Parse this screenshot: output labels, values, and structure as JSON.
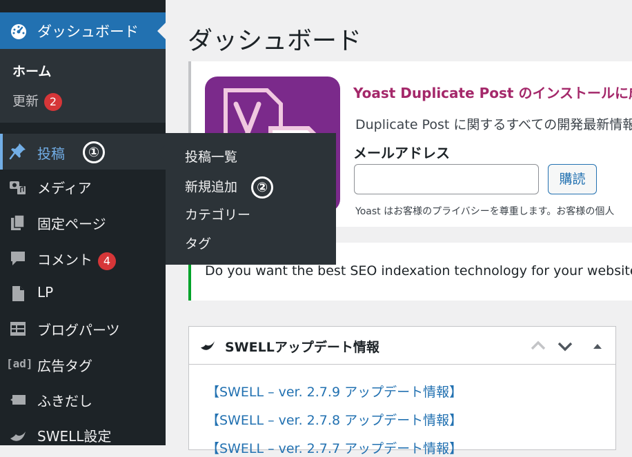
{
  "sidebar": {
    "dashboard": {
      "label": "ダッシュボード",
      "icon": "dashboard-icon"
    },
    "submenu": {
      "home": "ホーム",
      "update": "更新",
      "update_badge": "2"
    },
    "items": [
      {
        "label": "投稿",
        "icon": "pin-icon",
        "annotation": "①"
      },
      {
        "label": "メディア",
        "icon": "media-icon"
      },
      {
        "label": "固定ページ",
        "icon": "pages-icon"
      },
      {
        "label": "コメント",
        "icon": "comment-icon",
        "badge": "4"
      },
      {
        "label": "LP",
        "icon": "document-icon"
      },
      {
        "label": "ブログパーツ",
        "icon": "layout-icon"
      },
      {
        "label": "広告タグ",
        "icon": "ad-icon",
        "icon_text": "[ad]"
      },
      {
        "label": "ふきだし",
        "icon": "speech-bubble-icon"
      },
      {
        "label": "SWELL設定",
        "icon": "swell-icon"
      }
    ]
  },
  "flyout": {
    "items": [
      "投稿一覧",
      "新規追加",
      "カテゴリー",
      "タグ"
    ],
    "annotation": "②"
  },
  "main": {
    "title": "ダッシュボード",
    "yoast": {
      "heading": "Yoast Duplicate Post のインストールに成功",
      "description": "Duplicate Post に関するすべての開発最新情報",
      "email_label": "メールアドレス",
      "email_value": "",
      "subscribe": "購読",
      "privacy": "Yoast はお客様のプライバシーを尊重します。お客様の個人"
    },
    "seo_notice": "Do you want the best SEO indexation technology for your website? Joi",
    "swell": {
      "title": "SWELLアップデート情報",
      "links": [
        "【SWELL – ver. 2.7.9 アップデート情報】",
        "【SWELL – ver. 2.7.8 アップデート情報】",
        "【SWELL – ver. 2.7.7 アップデート情報】"
      ]
    }
  },
  "colors": {
    "sidebar": "#1d2327",
    "accent": "#2271b1",
    "badge": "#d63638",
    "yoast": "#a4286a"
  }
}
